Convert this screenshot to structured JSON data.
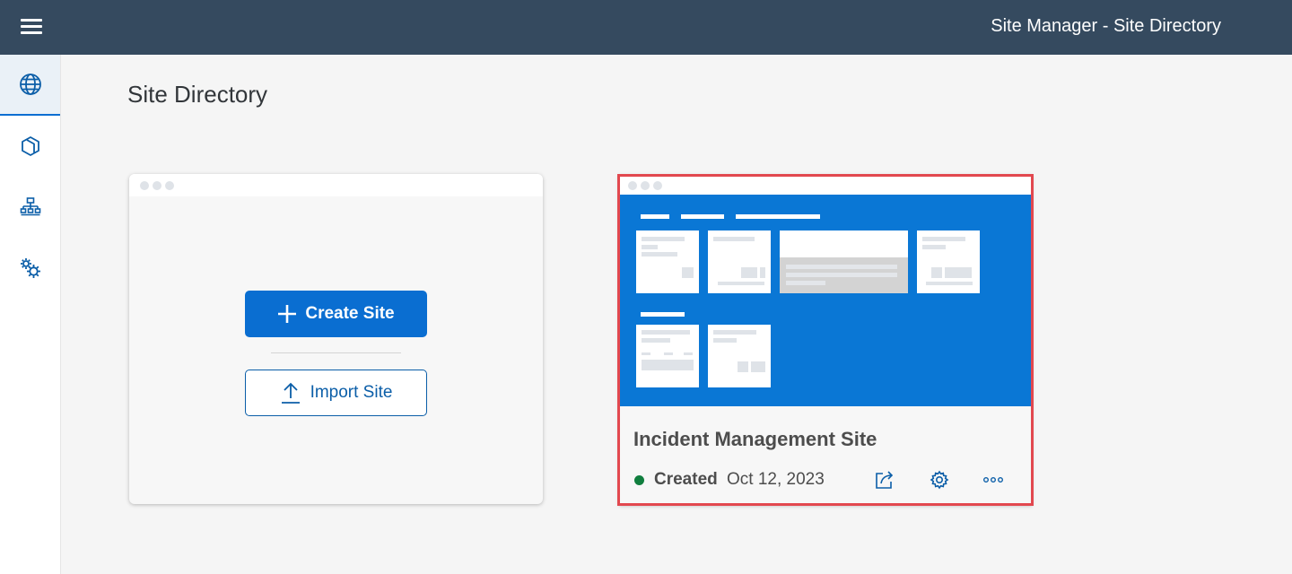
{
  "header": {
    "title": "Site Manager - Site Directory"
  },
  "sidebar": {
    "items": [
      {
        "name": "site-directory",
        "icon": "globe-icon",
        "active": true
      },
      {
        "name": "content-manager",
        "icon": "cube-icon",
        "active": false
      },
      {
        "name": "channel-manager",
        "icon": "hierarchy-icon",
        "active": false
      },
      {
        "name": "settings",
        "icon": "gears-icon",
        "active": false
      }
    ]
  },
  "main": {
    "page_title": "Site Directory",
    "create_card": {
      "create_label": "Create Site",
      "import_label": "Import Site"
    },
    "sites": [
      {
        "name": "Incident Management Site",
        "status": "Created",
        "date": "Oct 12, 2023",
        "status_color": "#107e3e"
      }
    ]
  },
  "colors": {
    "shell": "#354a5f",
    "accent": "#0a6ed1",
    "highlight": "#e2484f"
  }
}
